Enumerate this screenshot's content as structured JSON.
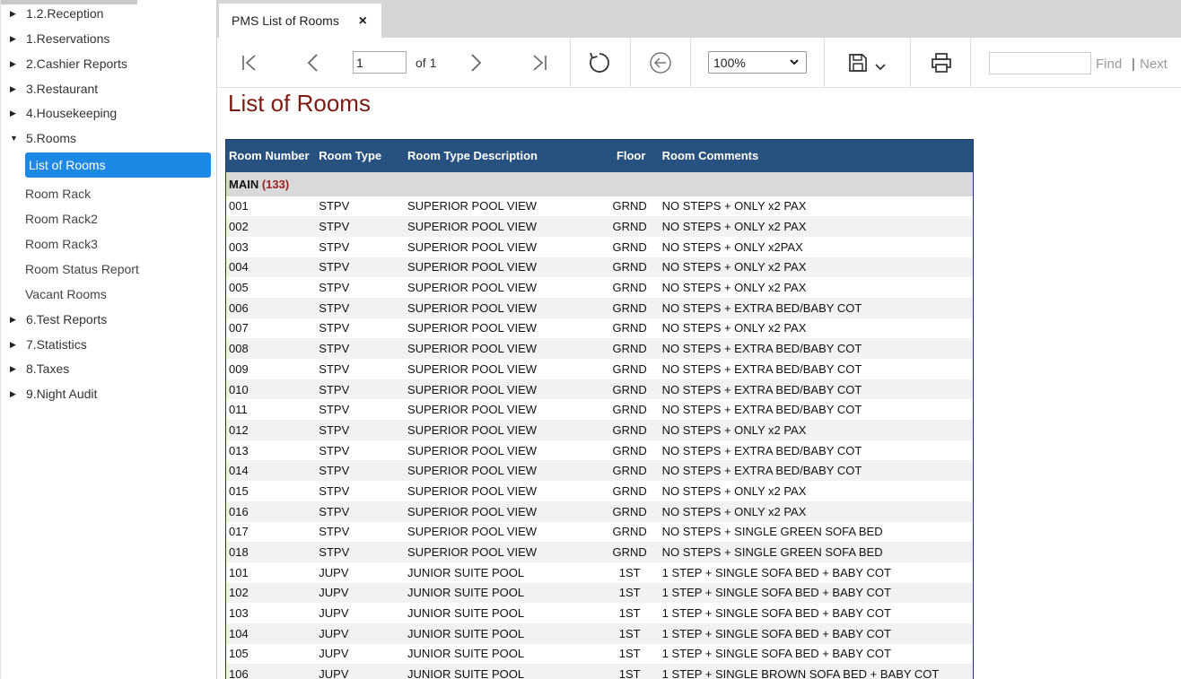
{
  "sidebar": {
    "items": [
      {
        "label": "1.2.Reception",
        "expanded": false
      },
      {
        "label": "1.Reservations",
        "expanded": false
      },
      {
        "label": "2.Cashier Reports",
        "expanded": false
      },
      {
        "label": "3.Restaurant",
        "expanded": false
      },
      {
        "label": "4.Housekeeping",
        "expanded": false
      },
      {
        "label": "5.Rooms",
        "expanded": true,
        "children": [
          "List of Rooms",
          "Room Rack",
          "Room Rack2",
          "Room Rack3",
          "Room Status Report",
          "Vacant Rooms"
        ],
        "active_child": "List of Rooms"
      },
      {
        "label": "6.Test Reports",
        "expanded": false
      },
      {
        "label": "7.Statistics",
        "expanded": false
      },
      {
        "label": "8.Taxes",
        "expanded": false
      },
      {
        "label": "9.Night Audit",
        "expanded": false
      }
    ]
  },
  "tab": {
    "label": "PMS List of Rooms",
    "close_icon": "×"
  },
  "toolbar": {
    "page_value": "1",
    "of_pages": "of 1",
    "zoom": "100%",
    "find_value": "",
    "find_label": "Find",
    "separator": "|",
    "next_label": "Next"
  },
  "report": {
    "title": "List of Rooms",
    "columns": [
      "Room Number",
      "Room Type",
      "Room Type Description",
      "Floor",
      "Room Comments"
    ],
    "group": {
      "name": "MAIN",
      "count": "(133)"
    },
    "rows": [
      [
        "001",
        "STPV",
        "SUPERIOR POOL  VIEW",
        "GRND",
        "NO STEPS + ONLY x2 PAX"
      ],
      [
        "002",
        "STPV",
        "SUPERIOR POOL  VIEW",
        "GRND",
        "NO STEPS + ONLY x2 PAX"
      ],
      [
        "003",
        "STPV",
        "SUPERIOR POOL  VIEW",
        "GRND",
        "NO STEPS + ONLY x2PAX"
      ],
      [
        "004",
        "STPV",
        "SUPERIOR POOL  VIEW",
        "GRND",
        "NO STEPS + ONLY x2 PAX"
      ],
      [
        "005",
        "STPV",
        "SUPERIOR POOL  VIEW",
        "GRND",
        "NO STEPS + ONLY x2 PAX"
      ],
      [
        "006",
        "STPV",
        "SUPERIOR POOL  VIEW",
        "GRND",
        "NO STEPS + EXTRA BED/BABY COT"
      ],
      [
        "007",
        "STPV",
        "SUPERIOR POOL  VIEW",
        "GRND",
        "NO STEPS + ONLY x2 PAX"
      ],
      [
        "008",
        "STPV",
        "SUPERIOR POOL  VIEW",
        "GRND",
        "NO STEPS + EXTRA BED/BABY COT"
      ],
      [
        "009",
        "STPV",
        "SUPERIOR POOL  VIEW",
        "GRND",
        "NO STEPS + EXTRA BED/BABY COT"
      ],
      [
        "010",
        "STPV",
        "SUPERIOR POOL  VIEW",
        "GRND",
        "NO STEPS + EXTRA BED/BABY COT"
      ],
      [
        "011",
        "STPV",
        "SUPERIOR POOL  VIEW",
        "GRND",
        "NO STEPS + EXTRA BED/BABY COT"
      ],
      [
        "012",
        "STPV",
        "SUPERIOR POOL  VIEW",
        "GRND",
        "NO STEPS + ONLY x2 PAX"
      ],
      [
        "013",
        "STPV",
        "SUPERIOR POOL  VIEW",
        "GRND",
        "NO STEPS + EXTRA BED/BABY COT"
      ],
      [
        "014",
        "STPV",
        "SUPERIOR POOL  VIEW",
        "GRND",
        "NO STEPS + EXTRA BED/BABY COT"
      ],
      [
        "015",
        "STPV",
        "SUPERIOR POOL  VIEW",
        "GRND",
        "NO STEPS + ONLY x2 PAX"
      ],
      [
        "016",
        "STPV",
        "SUPERIOR POOL  VIEW",
        "GRND",
        "NO STEPS + ONLY x2 PAX"
      ],
      [
        "017",
        "STPV",
        "SUPERIOR POOL  VIEW",
        "GRND",
        "NO STEPS + SINGLE GREEN SOFA BED"
      ],
      [
        "018",
        "STPV",
        "SUPERIOR POOL  VIEW",
        "GRND",
        "NO STEPS + SINGLE GREEN SOFA BED"
      ],
      [
        "101",
        "JUPV",
        "JUNIOR SUITE POOL",
        "1ST",
        "1 STEP + SINGLE SOFA BED + BABY COT"
      ],
      [
        "102",
        "JUPV",
        "JUNIOR SUITE POOL",
        "1ST",
        "1 STEP + SINGLE SOFA BED + BABY COT"
      ],
      [
        "103",
        "JUPV",
        "JUNIOR SUITE POOL",
        "1ST",
        "1 STEP + SINGLE SOFA BED + BABY COT"
      ],
      [
        "104",
        "JUPV",
        "JUNIOR SUITE POOL",
        "1ST",
        "1 STEP + SINGLE SOFA BED + BABY COT"
      ],
      [
        "105",
        "JUPV",
        "JUNIOR SUITE POOL",
        "1ST",
        "1 STEP + SINGLE SOFA BED + BABY COT"
      ],
      [
        "106",
        "JUPV",
        "JUNIOR SUITE POOL",
        "1ST",
        "1 STEP + SINGLE BROWN SOFA BED + BABY COT"
      ]
    ]
  },
  "colors": {
    "header_bg": "#27527f",
    "active_item": "#1e88e5",
    "title": "#7b1a12",
    "group_count": "#9b1f1f"
  },
  "icons": {
    "caret_right": "▶",
    "caret_down": "▼",
    "first_page": "first-page-icon",
    "prev_page": "prev-page-icon",
    "next_page": "next-page-icon",
    "last_page": "last-page-icon",
    "refresh": "refresh-icon",
    "back": "back-icon",
    "save": "save-icon",
    "print": "print-icon"
  }
}
